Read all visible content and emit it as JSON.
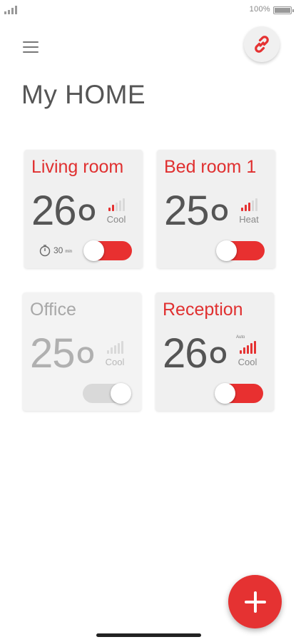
{
  "status_bar": {
    "battery_text": "100%"
  },
  "header": {
    "title": "My HOME",
    "menu_icon": "hamburger-menu-icon",
    "link_icon": "link-icon"
  },
  "theme": {
    "accent": "#e53232",
    "card_bg": "#f0f0f0",
    "text": "#555555",
    "inactive": "#b0b0b0"
  },
  "rooms": [
    {
      "name": "Living room",
      "temp": "26",
      "mode": "Cool",
      "level": 2,
      "power_on": true,
      "timer": "30",
      "timer_unit": "min"
    },
    {
      "name": "Bed room 1",
      "temp": "25",
      "mode": "Heat",
      "level": 3,
      "power_on": true
    },
    {
      "name": "Office",
      "temp": "25",
      "mode": "Cool",
      "level": 0,
      "power_on": false
    },
    {
      "name": "Reception",
      "temp": "26",
      "mode": "Cool",
      "level": 5,
      "power_on": true,
      "auto_label": "Auto"
    }
  ],
  "fab": {
    "icon": "plus-icon"
  }
}
